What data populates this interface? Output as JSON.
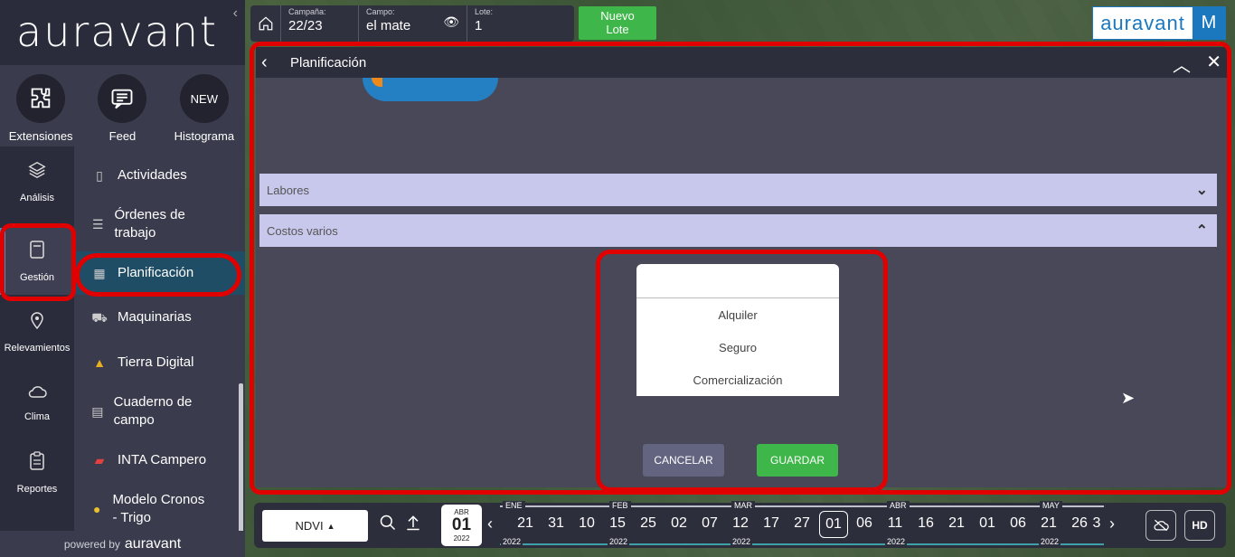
{
  "sidebar": {
    "logo": "auravant",
    "quick": [
      {
        "label": "Extensiones",
        "icon": "puzzle-icon"
      },
      {
        "label": "Feed",
        "icon": "feed-icon"
      },
      {
        "label": "Histograma",
        "icon": "new-badge",
        "badge": "NEW"
      }
    ],
    "main_nav": [
      {
        "label": "Análisis",
        "icon": "layers-icon"
      },
      {
        "label": "Gestión",
        "icon": "notebook-icon"
      },
      {
        "label": "Relevamientos",
        "icon": "location-pin-icon"
      },
      {
        "label": "Clima",
        "icon": "cloud-icon"
      },
      {
        "label": "Reportes",
        "icon": "clipboard-icon"
      }
    ],
    "sub_nav": [
      {
        "label": "Actividades",
        "icon": "notebook-icon"
      },
      {
        "label": "Órdenes de trabajo",
        "icon": "stack-icon"
      },
      {
        "label": "Planificación",
        "icon": "calendar-icon"
      },
      {
        "label": "Maquinarias",
        "icon": "tractor-icon"
      },
      {
        "label": "Tierra Digital",
        "icon": "triangle-logo-icon"
      },
      {
        "label": "Cuaderno de campo",
        "icon": "field-notebook-icon"
      },
      {
        "label": "INTA Campero",
        "icon": "inta-logo-icon"
      },
      {
        "label": "Modelo Cronos - Trigo",
        "icon": "cronos-logo-icon"
      }
    ],
    "powered_prefix": "powered by",
    "powered_brand": "auravant"
  },
  "topbar": {
    "campana_label": "Campaña:",
    "campana_value": "22/23",
    "campo_label": "Campo:",
    "campo_value": "el mate",
    "lote_label": "Lote:",
    "lote_value": "1",
    "nuevo_line1": "Nuevo",
    "nuevo_line2": "Lote",
    "brand": "auravant",
    "user_initial": "M"
  },
  "panel": {
    "title": "Planificación",
    "sections": [
      "Labores",
      "Costos varios"
    ],
    "dropdown_options": [
      "Alquiler",
      "Seguro",
      "Comercialización"
    ],
    "cancel_label": "CANCELAR",
    "save_label": "GUARDAR"
  },
  "bottombar": {
    "layer": "NDVI",
    "current_date": {
      "month": "ABR",
      "day": "01",
      "year": "2022"
    },
    "days": [
      "21",
      "31",
      "10",
      "15",
      "25",
      "02",
      "07",
      "12",
      "17",
      "27",
      "01",
      "06",
      "11",
      "16",
      "21",
      "01",
      "06",
      "21",
      "26",
      "3"
    ],
    "months": [
      "ENE",
      "FEB",
      "MAR",
      "ABR",
      "MAY"
    ],
    "years": [
      "2022",
      "2022",
      "2022",
      "2022",
      "2022"
    ],
    "hd_label": "HD"
  },
  "colors": {
    "accent": "#2b9bd8",
    "green": "#3fb649",
    "brand_blue": "#1b77be",
    "highlight": "#e00000"
  }
}
